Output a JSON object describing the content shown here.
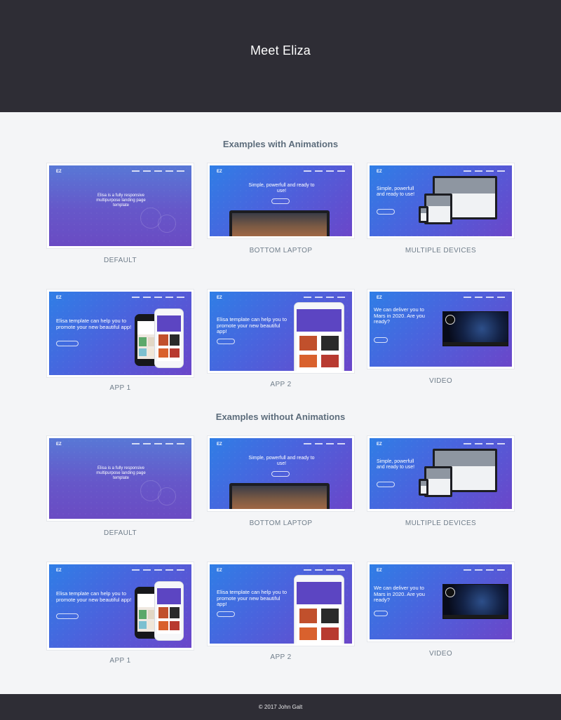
{
  "header": {
    "title": "Meet Eliza"
  },
  "sections": [
    {
      "title": "Examples with Animations",
      "items": [
        {
          "caption": "DEFAULT",
          "kind": "default",
          "headline": "Elisa is a fully responsive multipurpose landing page template"
        },
        {
          "caption": "BOTTOM LAPTOP",
          "kind": "laptop",
          "logo": "EZ",
          "headline": "Simple, powerfull and ready to use!"
        },
        {
          "caption": "MULTIPLE DEVICES",
          "kind": "devices",
          "logo": "EZ",
          "headline": "Simple, powerfull and ready to use!"
        },
        {
          "caption": "APP 1",
          "kind": "app1",
          "logo": "EZ",
          "headline": "Elisa template can help you to promote your new beautiful app!"
        },
        {
          "caption": "APP 2",
          "kind": "app2",
          "logo": "EZ",
          "headline": "Elisa template can help you to promote your new beautiful app!"
        },
        {
          "caption": "VIDEO",
          "kind": "video",
          "logo": "EZ",
          "headline": "We can deliver you to Mars in 2020. Are you ready?"
        }
      ]
    },
    {
      "title": "Examples without Animations",
      "items": [
        {
          "caption": "DEFAULT",
          "kind": "default",
          "headline": "Elisa is a fully responsive multipurpose landing page template"
        },
        {
          "caption": "BOTTOM LAPTOP",
          "kind": "laptop",
          "logo": "EZ",
          "headline": "Simple, powerfull and ready to use!"
        },
        {
          "caption": "MULTIPLE DEVICES",
          "kind": "devices",
          "logo": "EZ",
          "headline": "Simple, powerfull and ready to use!"
        },
        {
          "caption": "APP 1",
          "kind": "app1",
          "logo": "EZ",
          "headline": "Elisa template can help you to promote your new beautiful app!"
        },
        {
          "caption": "APP 2",
          "kind": "app2",
          "logo": "EZ",
          "headline": "Elisa template can help you to promote your new beautiful app!"
        },
        {
          "caption": "VIDEO",
          "kind": "video",
          "logo": "EZ",
          "headline": "We can deliver you to Mars in 2020. Are you ready?"
        }
      ]
    }
  ],
  "footer": {
    "copyright": "© 2017 John Galt"
  },
  "colors": {
    "dark": "#2e2d35",
    "background": "#f4f5f7",
    "gradient_start": "#2f7ee6",
    "gradient_end": "#6b46c9"
  }
}
